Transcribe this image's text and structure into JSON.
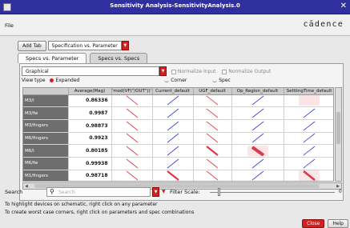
{
  "window": {
    "title": "Sensitivity Analysis-SensitivityAnalysis.0"
  },
  "menu": {
    "file": "File",
    "logo": "cādence"
  },
  "toolbar": {
    "add_tab": "Add Tab",
    "view_select": "Specification vs. Parameter"
  },
  "tabs": [
    {
      "label": "Specs vs. Parameter",
      "active": true
    },
    {
      "label": "Specs vs. Specs",
      "active": false
    }
  ],
  "options": {
    "display_select": "Graphical",
    "normalize_input": "Normalize Input",
    "normalize_output": "Normalize Output",
    "view_type_label": "View type",
    "expanded": "Expanded",
    "corner": "Corner",
    "spec": "Spec"
  },
  "grid": {
    "columns": [
      "",
      "Average(Mag)",
      "'mod(VF(\"/OUT\"))'",
      "Current_default",
      "UGF_default",
      "Op_Region_default",
      "SettlingTime_default"
    ],
    "rows": [
      {
        "name": "M3/l",
        "avg": "0.86336",
        "cells": [
          "down-thin",
          "up-thin",
          "down-thin",
          "up-thin",
          "fill"
        ]
      },
      {
        "name": "M3/fw",
        "avg": "0.9987",
        "cells": [
          "down-thin",
          "up-thin",
          "down-thin",
          "up-thin",
          "up-thin"
        ]
      },
      {
        "name": "M3/fingers",
        "avg": "0.98873",
        "cells": [
          "down-thin",
          "up-thin",
          "down-thin",
          "up-thin",
          "up-thin"
        ]
      },
      {
        "name": "M6/fingers",
        "avg": "0.9923",
        "cells": [
          "down-thin",
          "up-thin",
          "down-thin",
          "up-thin",
          "up-thin"
        ]
      },
      {
        "name": "M6/l",
        "avg": "0.80185",
        "cells": [
          "down-thin",
          "up-thin",
          "down-thick",
          "down-fat",
          "up-thin"
        ]
      },
      {
        "name": "M6/fw",
        "avg": "0.99938",
        "cells": [
          "down-thin",
          "up-thin",
          "down-thin",
          "up-thin",
          "up-thin"
        ]
      },
      {
        "name": "M1/fingers",
        "avg": "0.98718",
        "cells": [
          "down-thin",
          "down-thick",
          "down-thin",
          "up-thin",
          "down-thick-fill"
        ]
      }
    ]
  },
  "search": {
    "label": "Search",
    "placeholder": "Search",
    "filter_label": "Filter Scale:",
    "scale_value": "0"
  },
  "hints": {
    "line1": "To highlight devices on schematic, right click on any parameter",
    "line2": "To create worst case corners, right click on parameters and spec combinations"
  },
  "buttons": {
    "close": "Close",
    "help": "Help"
  },
  "colors": {
    "titlebar": "#2f2fa0",
    "up_line": "#3a3ad8",
    "down_line": "#e0384a",
    "accent": "#d21f1f",
    "row_header": "#6e6e6e"
  }
}
